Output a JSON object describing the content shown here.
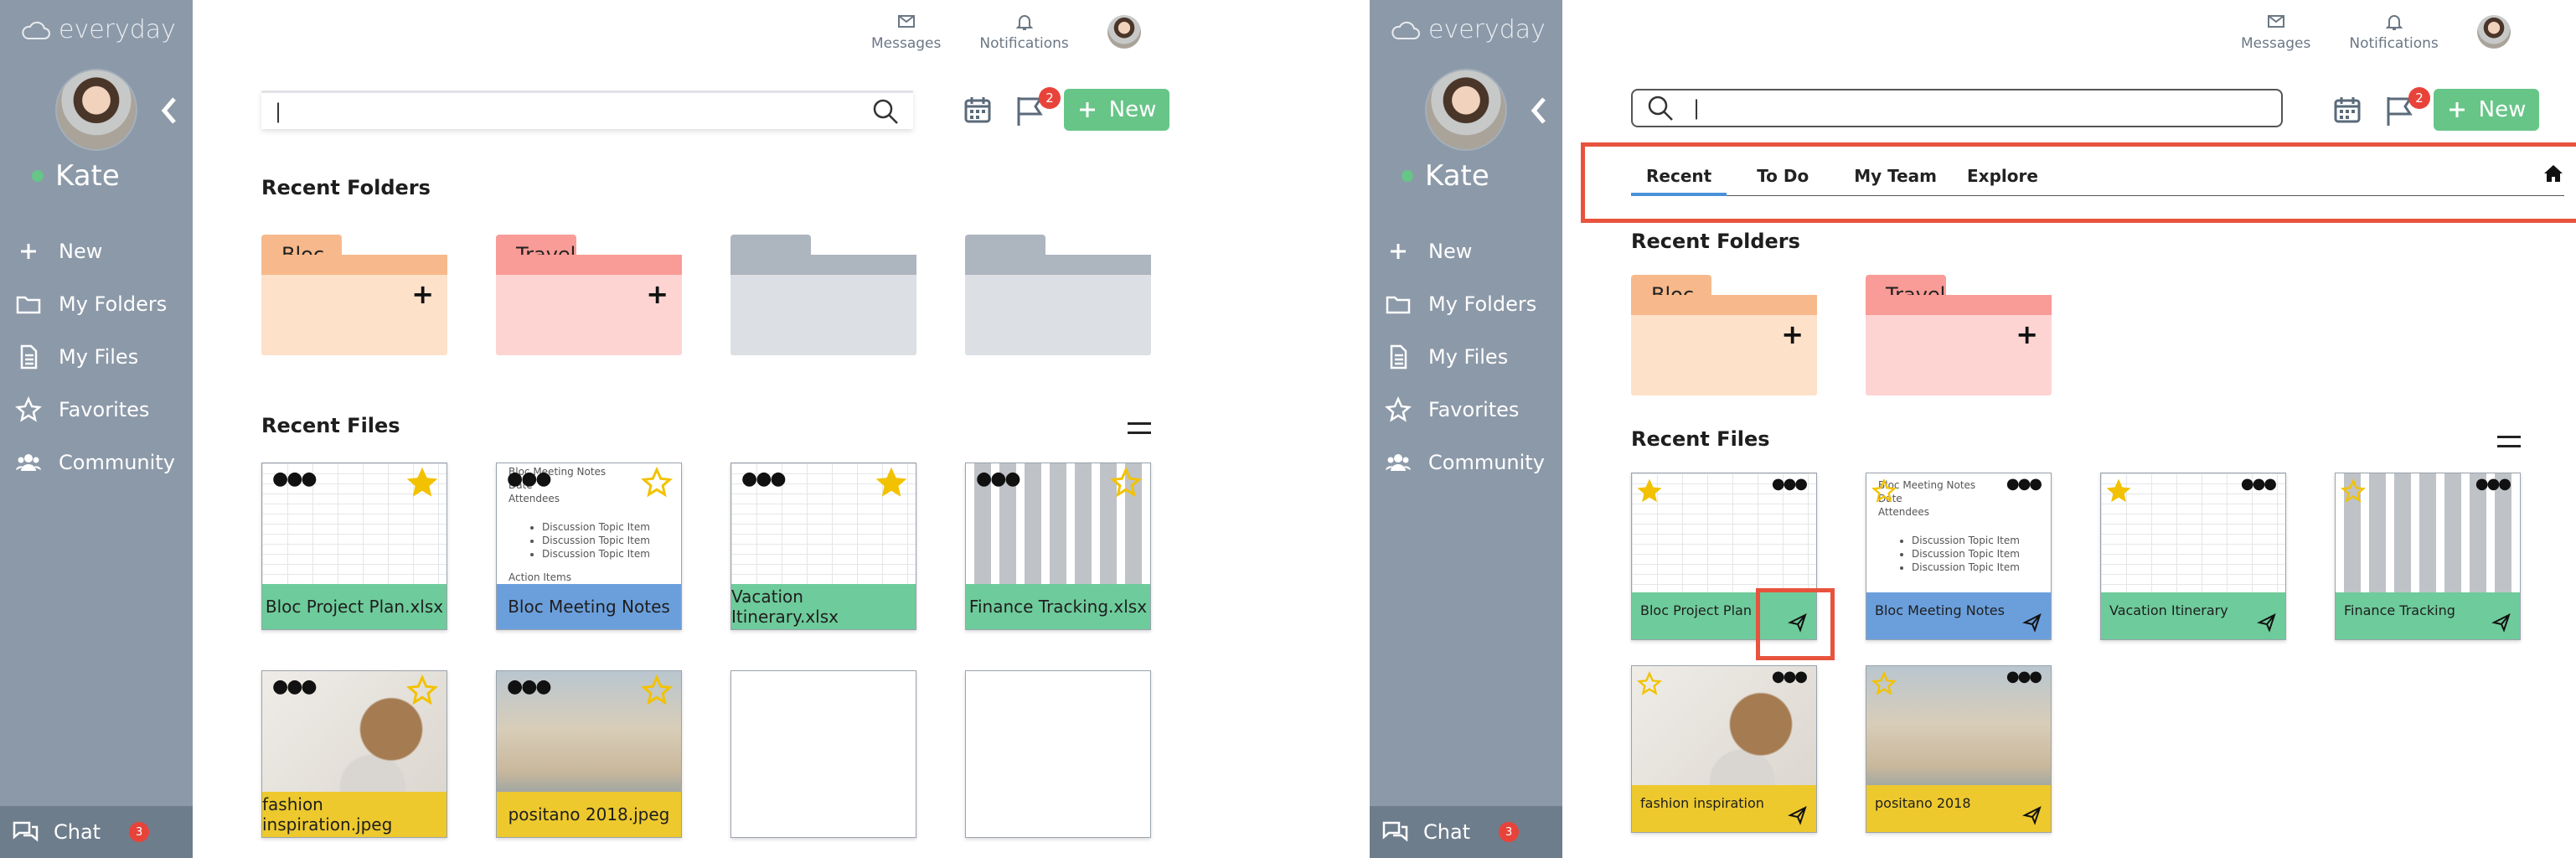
{
  "app": {
    "name": "everyday"
  },
  "user": {
    "name": "Kate"
  },
  "nav": [
    {
      "label": "New",
      "icon": "plus-icon"
    },
    {
      "label": "My Folders",
      "icon": "folder-icon"
    },
    {
      "label": "My Files",
      "icon": "file-icon"
    },
    {
      "label": "Favorites",
      "icon": "star-icon"
    },
    {
      "label": "Community",
      "icon": "users-icon"
    }
  ],
  "chat": {
    "label": "Chat",
    "count": "3"
  },
  "header": {
    "messages": "Messages",
    "notifications": "Notifications",
    "flag_count": "2",
    "new_label": "New"
  },
  "search": {
    "value": "|"
  },
  "tabs": [
    "Recent",
    "To Do",
    "My Team",
    "Explore"
  ],
  "sections": {
    "recent_folders": "Recent Folders",
    "recent_files": "Recent Files"
  },
  "folders": [
    {
      "name": "Bloc",
      "tab_color": "#f7b98b",
      "body_color": "#fde1c9"
    },
    {
      "name": "Travel",
      "tab_color": "#f99b96",
      "body_color": "#fdd4d2"
    },
    {
      "name": "",
      "tab_color": "#adb5bf",
      "body_color": "#dcdfe3"
    },
    {
      "name": "",
      "tab_color": "#adb5bf",
      "body_color": "#dcdfe3"
    }
  ],
  "files_left": [
    {
      "name": "Bloc Project Plan.xlsx",
      "color": "#6ecb9b",
      "starred": true
    },
    {
      "name": "Bloc Meeting Notes",
      "color": "#6b9fdc",
      "starred": false
    },
    {
      "name": "Vacation Itinerary.xlsx",
      "color": "#6ecb9b",
      "starred": true
    },
    {
      "name": "Finance Tracking.xlsx",
      "color": "#6ecb9b",
      "starred": false
    },
    {
      "name": "fashion inspiration.jpeg",
      "color": "#edc92e",
      "starred": false
    },
    {
      "name": "positano 2018.jpeg",
      "color": "#edc92e",
      "starred": false
    }
  ],
  "files_right": [
    {
      "name": "Bloc Project Plan",
      "color": "#6ecb9b",
      "starred": true
    },
    {
      "name": "Bloc Meeting Notes",
      "color": "#6b9fdc",
      "starred": false
    },
    {
      "name": "Vacation Itinerary",
      "color": "#6ecb9b",
      "starred": true
    },
    {
      "name": "Finance Tracking",
      "color": "#6ecb9b",
      "starred": false
    },
    {
      "name": "fashion inspiration",
      "color": "#edc92e",
      "starred": false
    },
    {
      "name": "positano 2018",
      "color": "#edc92e",
      "starred": false
    }
  ],
  "doc_preview": {
    "title": "Bloc Meeting Notes",
    "date": "Date",
    "attendees": "Attendees",
    "items": [
      "Discussion Topic Item",
      "Discussion Topic Item",
      "Discussion Topic Item"
    ],
    "footer": "Action Items"
  },
  "colors": {
    "sidebar": "#8c99a8",
    "accent": "#67c587",
    "badge": "#e8433a",
    "highlight": "#e8533d",
    "tab_active": "#4a90d9",
    "star": "#f2c200"
  }
}
